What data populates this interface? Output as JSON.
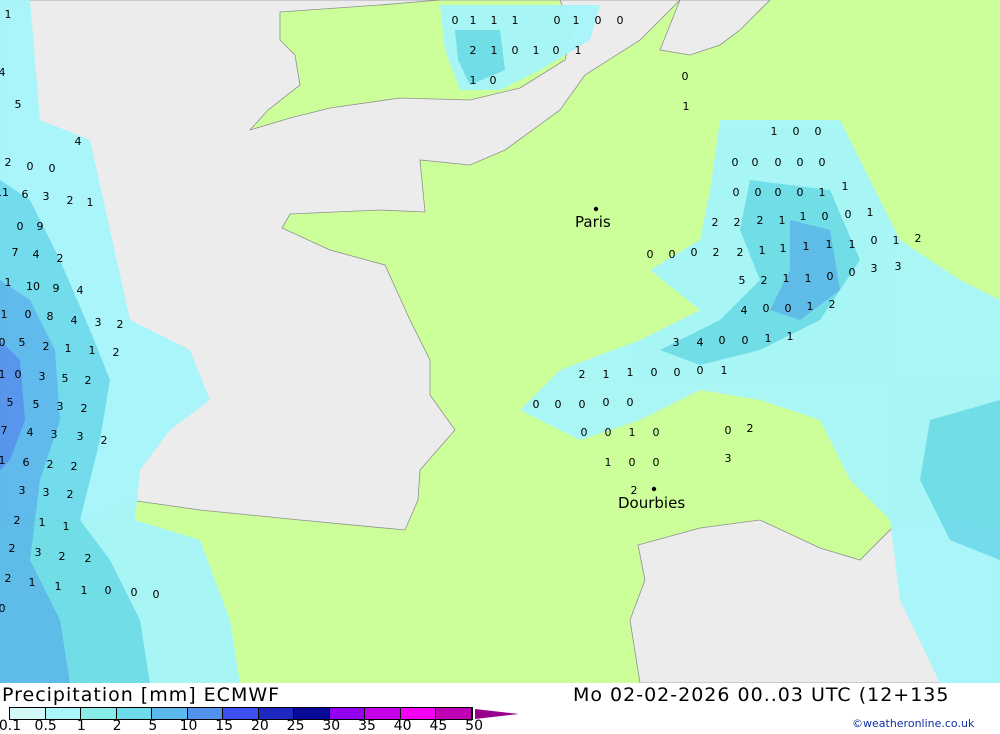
{
  "title": "Precipitation [mm] ECMWF",
  "datetime": "Mo 02-02-2026 00..03 UTC (12+135",
  "credit": "©weatheronline.co.uk",
  "colors": {
    "land": "#ccff99",
    "sea": "#ececec",
    "border": "#909090"
  },
  "legend": {
    "ticks": [
      "0.1",
      "0.5",
      "1",
      "2",
      "5",
      "10",
      "15",
      "20",
      "25",
      "30",
      "35",
      "40",
      "45",
      "50"
    ],
    "colors": [
      "#d2f8f8",
      "#a6f6fa",
      "#88ece8",
      "#6cdcec",
      "#5ab8ec",
      "#5092ec",
      "#3c50f0",
      "#1c28c0",
      "#0a0a98",
      "#9400f0",
      "#c400e8",
      "#f400f4",
      "#c000b4"
    ],
    "arrow_color": "#9a0090"
  },
  "cities": [
    {
      "name": "Paris"
    },
    {
      "name": "Dourbies"
    }
  ],
  "precip_values": [
    "0",
    "1",
    "1",
    "1",
    "0",
    "1",
    "0",
    "0",
    "2",
    "1",
    "0",
    "1",
    "0",
    "1",
    "1",
    "0",
    "0",
    "1",
    "1",
    "0",
    "0",
    "0",
    "0",
    "0",
    "0",
    "0",
    "0",
    "0",
    "0",
    "0",
    "1",
    "1",
    "2",
    "2",
    "2",
    "1",
    "1",
    "0",
    "0",
    "1",
    "0",
    "0",
    "0",
    "2",
    "2",
    "1",
    "1",
    "1",
    "1",
    "1",
    "0",
    "1",
    "2",
    "5",
    "2",
    "1",
    "1",
    "0",
    "0",
    "3",
    "3",
    "4",
    "0",
    "0",
    "1",
    "2",
    "3",
    "4",
    "0",
    "0",
    "1",
    "1",
    "2",
    "1",
    "1",
    "0",
    "0",
    "0",
    "1",
    "0",
    "0",
    "0",
    "0",
    "0",
    "0",
    "0",
    "1",
    "0",
    "0",
    "2",
    "1",
    "0",
    "0",
    "3",
    "2",
    "1",
    "4",
    "5",
    "4",
    "2",
    "0",
    "0",
    "11",
    "6",
    "3",
    "2",
    "1",
    "0",
    "9",
    "7",
    "4",
    "2",
    "1",
    "10",
    "9",
    "4",
    "1",
    "0",
    "8",
    "4",
    "3",
    "2",
    "0",
    "5",
    "2",
    "1",
    "1",
    "2",
    "1",
    "0",
    "3",
    "5",
    "2",
    "5",
    "5",
    "3",
    "2",
    "7",
    "4",
    "3",
    "3",
    "2",
    "1",
    "6",
    "2",
    "2",
    "3",
    "3",
    "2",
    "2",
    "1",
    "1",
    "2",
    "3",
    "2",
    "2",
    "2",
    "1",
    "1",
    "1",
    "0",
    "0",
    "0",
    "0"
  ]
}
